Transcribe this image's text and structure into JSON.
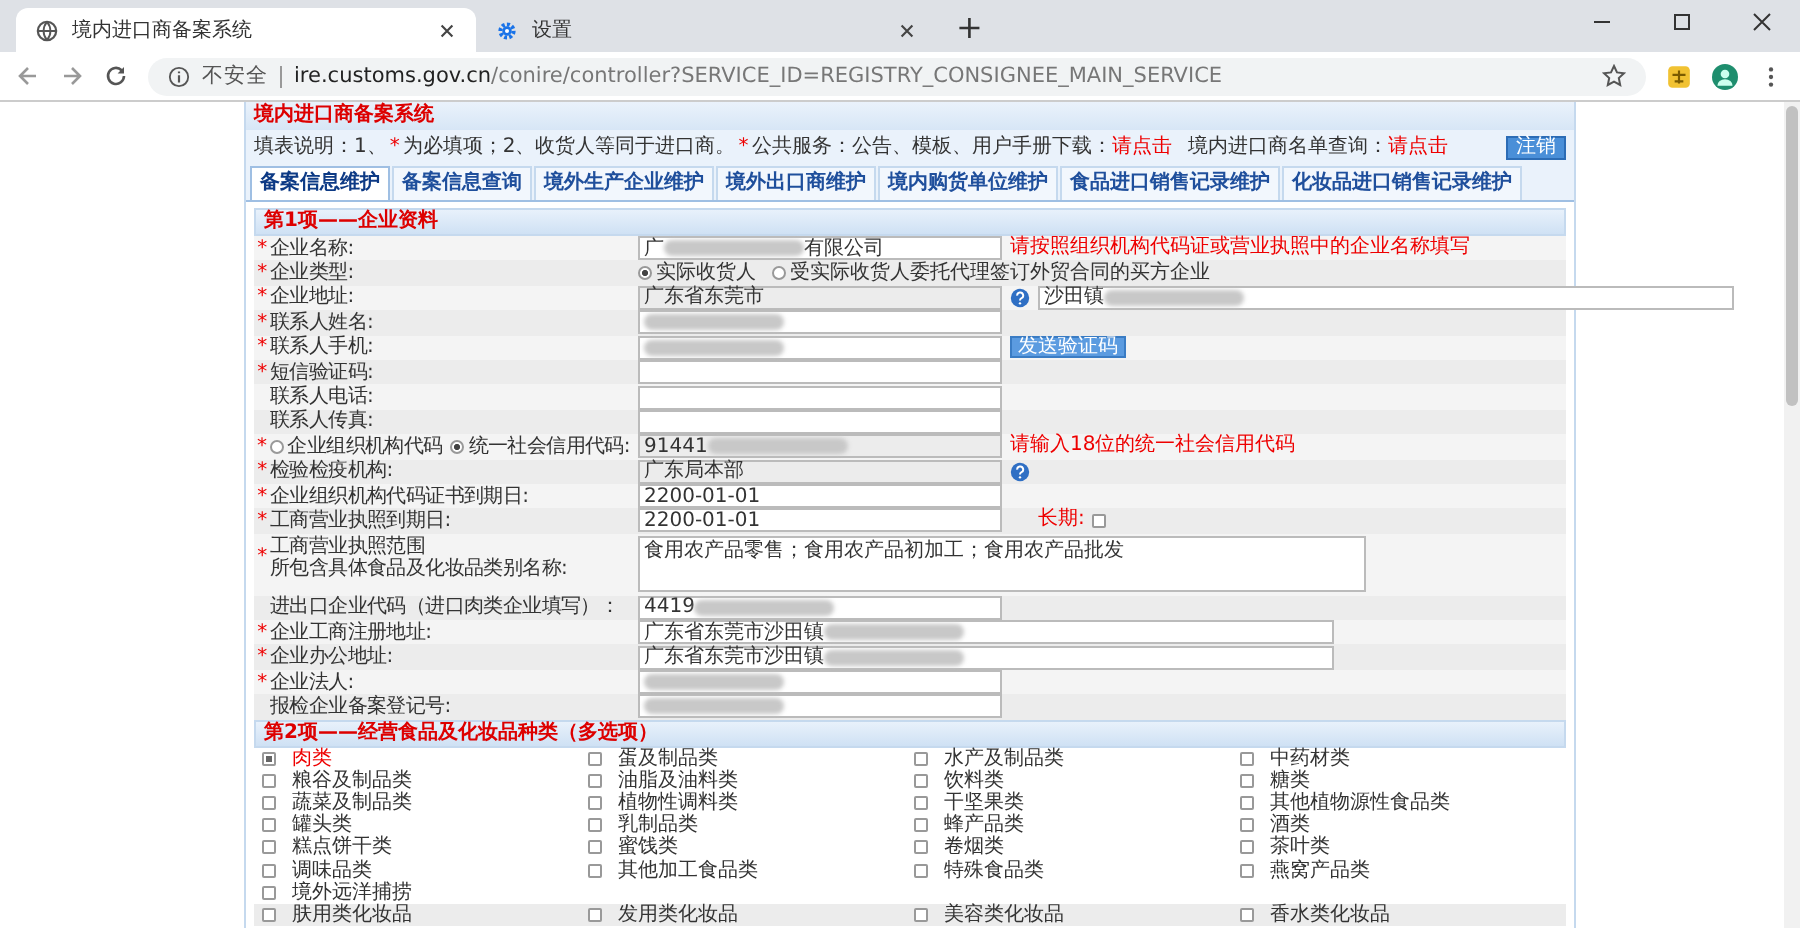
{
  "browser": {
    "tabs": [
      {
        "title": "境内进口商备案系统",
        "selected": true
      },
      {
        "title": "设置",
        "selected": false
      }
    ],
    "new_tab": "+",
    "security_label": "不安全",
    "url_host": "ire.customs.gov.cn",
    "url_path": "/conire/controller?SERVICE_ID=REGISTRY_CONSIGNEE_MAIN_SERVICE"
  },
  "system_title": "境内进口商备案系统",
  "notes": [
    {
      "text": "填表说明：1、",
      "kind": "text"
    },
    {
      "text": "*",
      "kind": "mark"
    },
    {
      "text": "为必填项；2、收货人等同于进口商。",
      "kind": "text"
    },
    {
      "text": "*",
      "kind": "mark"
    },
    {
      "text": "公共服务：公告、模板、用户手册下载：",
      "kind": "text"
    },
    {
      "text": "请点击",
      "kind": "link"
    },
    {
      "text": "境内进口商名单查询：",
      "kind": "text"
    },
    {
      "text": "请点击",
      "kind": "link"
    }
  ],
  "logout_button": "注销",
  "nav_tabs": [
    {
      "label": "备案信息维护",
      "selected": true
    },
    {
      "label": "备案信息查询",
      "selected": false
    },
    {
      "label": "境外生产企业维护",
      "selected": false
    },
    {
      "label": "境外出口商维护",
      "selected": false
    },
    {
      "label": "境内购货单位维护",
      "selected": false
    },
    {
      "label": "食品进口销售记录维护",
      "selected": false
    },
    {
      "label": "化妆品进口销售记录维护",
      "selected": false
    }
  ],
  "section1": {
    "title": "第1项——企业资料",
    "rows": [
      {
        "kind": "field",
        "label": "企业名称:",
        "required": true,
        "fields": [
          {
            "value": "广",
            "tail": "有限公司",
            "redacted": true,
            "readonly": false,
            "wide": false
          }
        ],
        "hint": "请按照组织机构代码证或营业执照中的企业名称填写"
      },
      {
        "kind": "radio",
        "label": "企业类型:",
        "required": true,
        "options": [
          {
            "label": "实际收货人",
            "selected": true
          },
          {
            "label": "受实际收货人委托代理签订外贸合同的买方企业",
            "selected": false
          }
        ]
      },
      {
        "kind": "field",
        "label": "企业地址:",
        "required": true,
        "fields": [
          {
            "value": "广东省东莞市",
            "readonly": true,
            "wide": false,
            "help_icon": true
          },
          {
            "value": "沙田镇",
            "redacted": true,
            "readonly": false,
            "wide": true
          }
        ]
      },
      {
        "kind": "field",
        "label": "联系人姓名:",
        "required": true,
        "fields": [
          {
            "redacted": true,
            "readonly": false,
            "wide": false
          }
        ]
      },
      {
        "kind": "field",
        "label": "联系人手机:",
        "required": true,
        "fields": [
          {
            "redacted": true,
            "readonly": false,
            "wide": false
          }
        ],
        "button": "发送验证码"
      },
      {
        "kind": "field",
        "label": "短信验证码:",
        "required": true,
        "fields": [
          {
            "readonly": false,
            "wide": false
          }
        ]
      },
      {
        "kind": "field",
        "label": "联系人电话:",
        "required": false,
        "fields": [
          {
            "readonly": false,
            "wide": false
          }
        ]
      },
      {
        "kind": "field",
        "label": "联系人传真:",
        "required": false,
        "fields": [
          {
            "readonly": false,
            "wide": false
          }
        ]
      },
      {
        "kind": "field",
        "label_options": [
          {
            "label": "企业组织机构代码",
            "selected": false
          },
          {
            "label": "统一社会信用代码:",
            "selected": true
          }
        ],
        "required": true,
        "fields": [
          {
            "value": "91441",
            "redacted": true,
            "readonly": true,
            "wide": false
          }
        ],
        "hint": "请输入18位的统一社会信用代码"
      },
      {
        "kind": "field",
        "label": "检验检疫机构:",
        "required": true,
        "fields": [
          {
            "value": "广东局本部",
            "readonly": true,
            "wide": false,
            "help_icon": true
          }
        ]
      },
      {
        "kind": "field",
        "label": "企业组织机构代码证书到期日:",
        "required": true,
        "fields": [
          {
            "value": "2200-01-01",
            "readonly": false,
            "wide": false
          }
        ]
      },
      {
        "kind": "field",
        "label": "工商营业执照到期日:",
        "required": true,
        "fields": [
          {
            "value": "2200-01-01",
            "readonly": false,
            "wide": false
          }
        ],
        "long_term": {
          "label": "长期:",
          "checked": false
        }
      },
      {
        "kind": "textarea",
        "label_lines": [
          "工商营业执照范围",
          "所包含具体食品及化妆品类别名称:"
        ],
        "required": true,
        "value": "食用农产品零售；食用农产品初加工；食用农产品批发"
      },
      {
        "kind": "field",
        "label": "进出口企业代码（进口肉类企业填写）：",
        "required": false,
        "fields": [
          {
            "value": "4419",
            "redacted": true,
            "readonly": false,
            "wide": false
          }
        ]
      },
      {
        "kind": "field",
        "label": "企业工商注册地址:",
        "required": true,
        "fields": [
          {
            "value": "广东省东莞市沙田镇",
            "redacted": true,
            "readonly": false,
            "wide": true
          }
        ]
      },
      {
        "kind": "field",
        "label": "企业办公地址:",
        "required": true,
        "fields": [
          {
            "value": "广东省东莞市沙田镇",
            "redacted": true,
            "readonly": false,
            "wide": true
          }
        ]
      },
      {
        "kind": "field",
        "label": "企业法人:",
        "required": true,
        "fields": [
          {
            "redacted": true,
            "readonly": false,
            "wide": false
          }
        ]
      },
      {
        "kind": "field",
        "label": "报检企业备案登记号:",
        "required": false,
        "fields": [
          {
            "redacted": true,
            "readonly": false,
            "wide": false
          }
        ]
      }
    ]
  },
  "section2": {
    "title": "第2项——经营食品及化妆品种类（多选项）",
    "food": [
      {
        "label": "肉类",
        "checked": true
      },
      {
        "label": "蛋及制品类",
        "checked": false
      },
      {
        "label": "水产及制品类",
        "checked": false
      },
      {
        "label": "中药材类",
        "checked": false
      },
      {
        "label": "粮谷及制品类",
        "checked": false
      },
      {
        "label": "油脂及油料类",
        "checked": false
      },
      {
        "label": "饮料类",
        "checked": false
      },
      {
        "label": "糖类",
        "checked": false
      },
      {
        "label": "蔬菜及制品类",
        "checked": false
      },
      {
        "label": "植物性调料类",
        "checked": false
      },
      {
        "label": "干坚果类",
        "checked": false
      },
      {
        "label": "其他植物源性食品类",
        "checked": false
      },
      {
        "label": "罐头类",
        "checked": false
      },
      {
        "label": "乳制品类",
        "checked": false
      },
      {
        "label": "蜂产品类",
        "checked": false
      },
      {
        "label": "酒类",
        "checked": false
      },
      {
        "label": "糕点饼干类",
        "checked": false
      },
      {
        "label": "蜜饯类",
        "checked": false
      },
      {
        "label": "卷烟类",
        "checked": false
      },
      {
        "label": "茶叶类",
        "checked": false
      },
      {
        "label": "调味品类",
        "checked": false
      },
      {
        "label": "其他加工食品类",
        "checked": false
      },
      {
        "label": "特殊食品类",
        "checked": false
      },
      {
        "label": "燕窝产品类",
        "checked": false
      },
      {
        "label": "境外远洋捕捞",
        "checked": false
      }
    ],
    "cosmetics": [
      {
        "label": "肤用类化妆品",
        "checked": false
      },
      {
        "label": "发用类化妆品",
        "checked": false
      },
      {
        "label": "美容类化妆品",
        "checked": false
      },
      {
        "label": "香水类化妆品",
        "checked": false
      }
    ]
  }
}
